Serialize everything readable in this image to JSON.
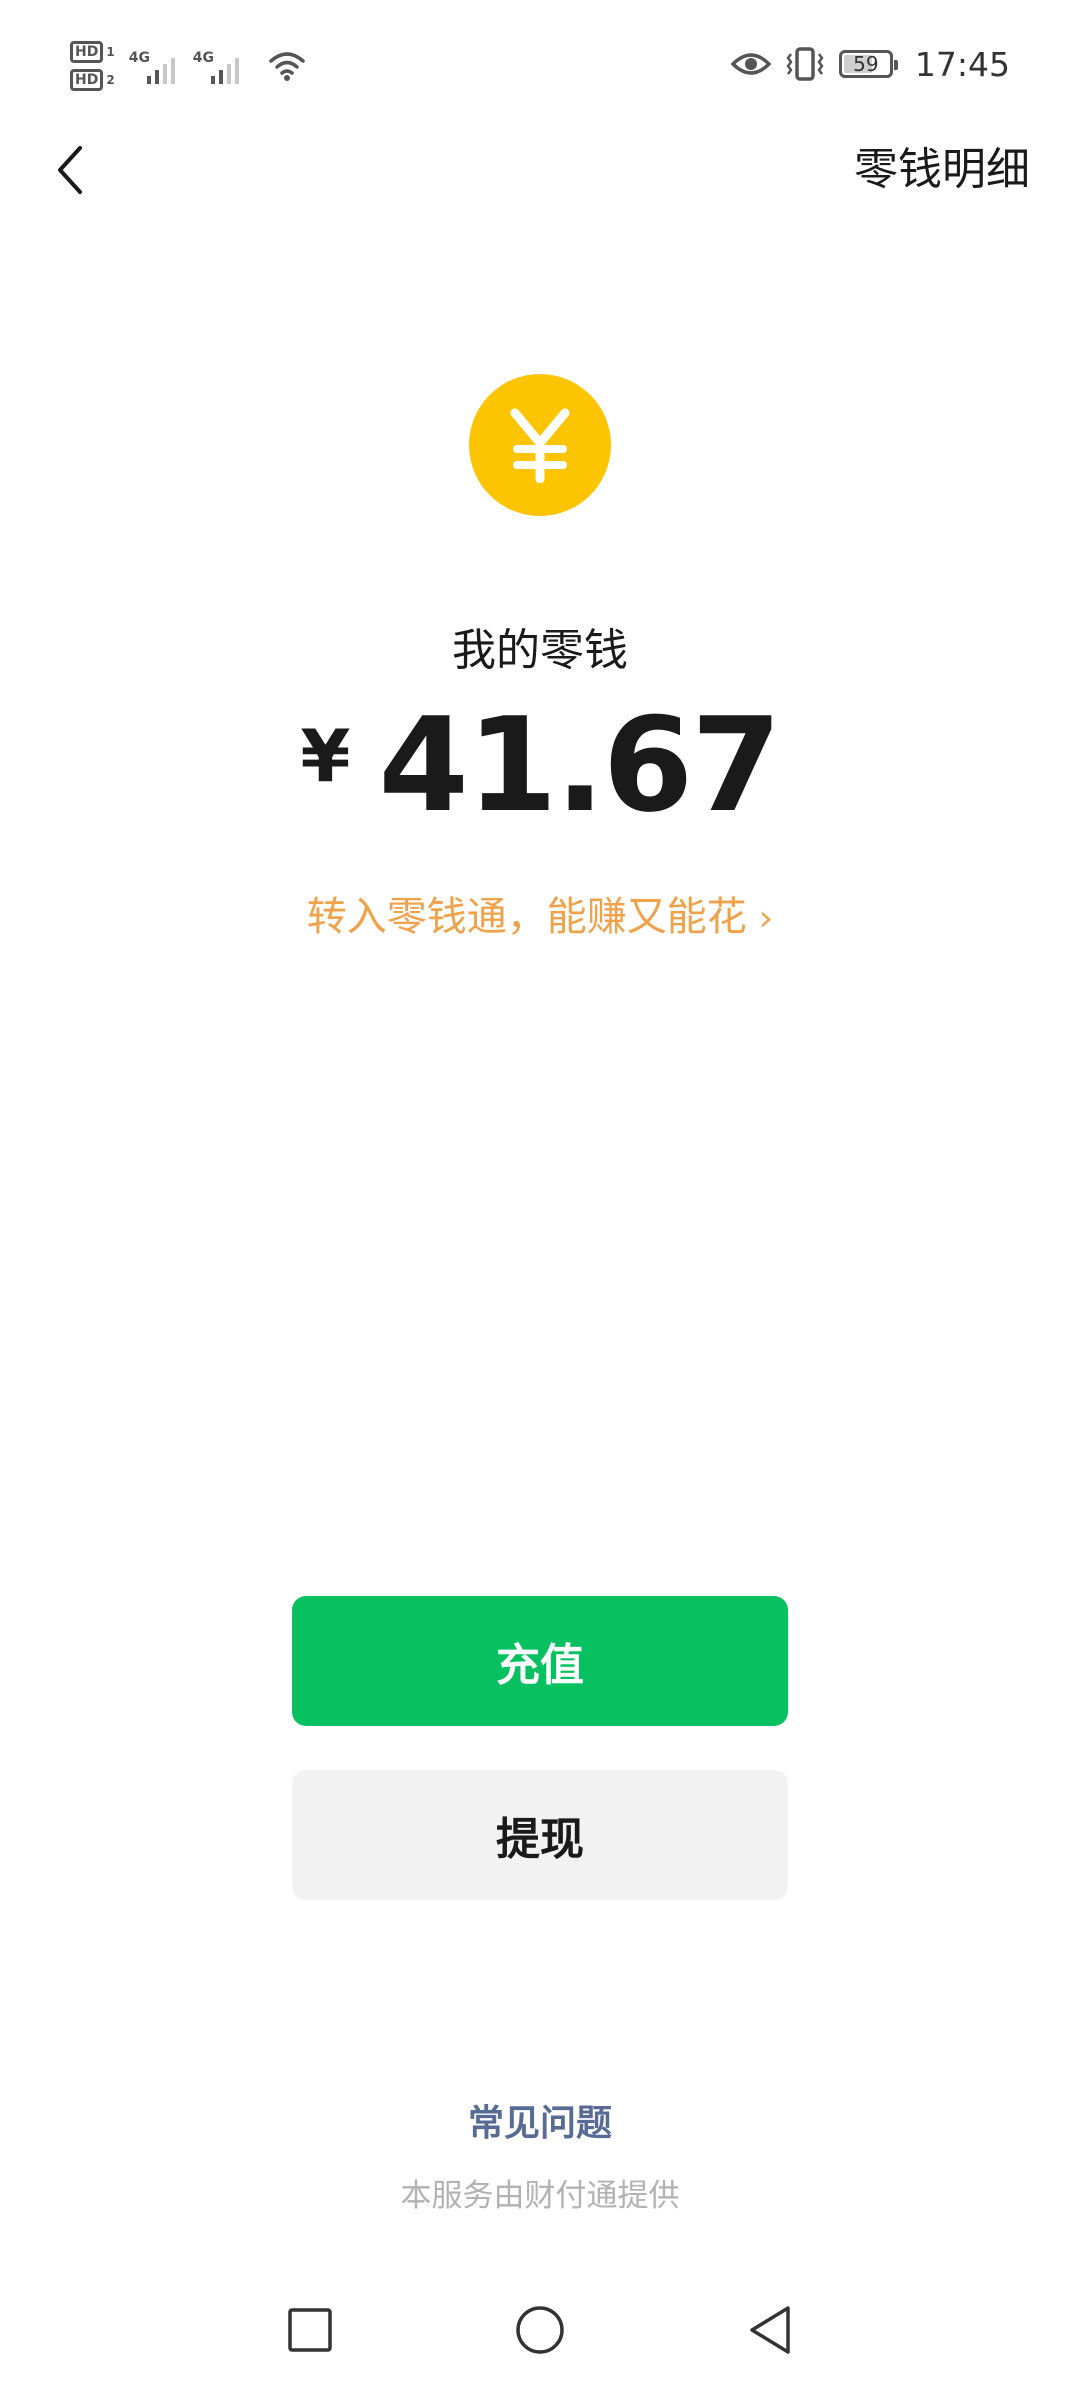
{
  "status_bar": {
    "sim1_label": "HD",
    "sim1_index": "1",
    "sim2_label": "HD",
    "sim2_index": "2",
    "network1": "4G",
    "network2": "4G",
    "battery_level": "59",
    "time": "17:45"
  },
  "header": {
    "detail_link": "零钱明细"
  },
  "balance": {
    "coin_symbol": "¥",
    "title": "我的零钱",
    "currency_sign": "¥",
    "amount": "41.67",
    "promo_text": "转入零钱通，能赚又能花",
    "promo_arrow": "›"
  },
  "actions": {
    "topup_label": "充值",
    "withdraw_label": "提现"
  },
  "footer": {
    "faq_link": "常见问题",
    "provider_note": "本服务由财付通提供"
  },
  "colors": {
    "coin": "#fcc401",
    "primary_button": "#07c160",
    "secondary_button": "#f2f2f2",
    "promo": "#f0a24b",
    "faq_link": "#576b95"
  },
  "icons": {
    "back": "chevron-left-icon",
    "wifi": "wifi-icon",
    "eye": "eye-icon",
    "vibrate": "vibrate-icon",
    "recent_apps": "square-icon",
    "home": "circle-icon",
    "system_back": "triangle-left-icon"
  }
}
